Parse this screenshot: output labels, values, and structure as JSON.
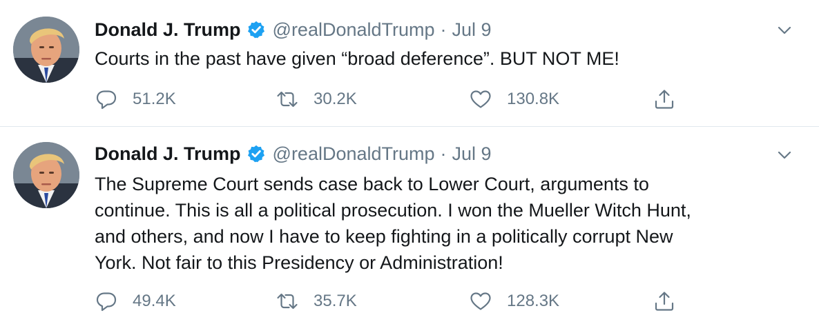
{
  "tweets": [
    {
      "author": {
        "name": "Donald J. Trump",
        "handle": "@realDonaldTrump",
        "verified": true
      },
      "separator": "·",
      "date": "Jul 9",
      "lines": [
        "Courts in the past have given “broad deference”. BUT NOT ME!"
      ],
      "stats": {
        "replies": "51.2K",
        "retweets": "30.2K",
        "likes": "130.8K"
      }
    },
    {
      "author": {
        "name": "Donald J. Trump",
        "handle": "@realDonaldTrump",
        "verified": true
      },
      "separator": "·",
      "date": "Jul 9",
      "lines": [
        "The Supreme Court sends case back to Lower Court, arguments to",
        "continue. This is all a political prosecution. I won the Mueller Witch Hunt,",
        "and others, and now I have to keep fighting in a politically corrupt New",
        "York. Not fair to this Presidency or Administration!"
      ],
      "stats": {
        "replies": "49.4K",
        "retweets": "35.7K",
        "likes": "128.3K"
      }
    }
  ],
  "icons": {
    "reply": "reply-icon",
    "retweet": "retweet-icon",
    "like": "like-icon",
    "share": "share-icon",
    "verified": "verified-badge-icon",
    "menu": "chevron-down-icon"
  },
  "colors": {
    "text": "#14171a",
    "secondary": "#657786",
    "verified": "#1da1f2",
    "divider": "#e1e8ed"
  }
}
